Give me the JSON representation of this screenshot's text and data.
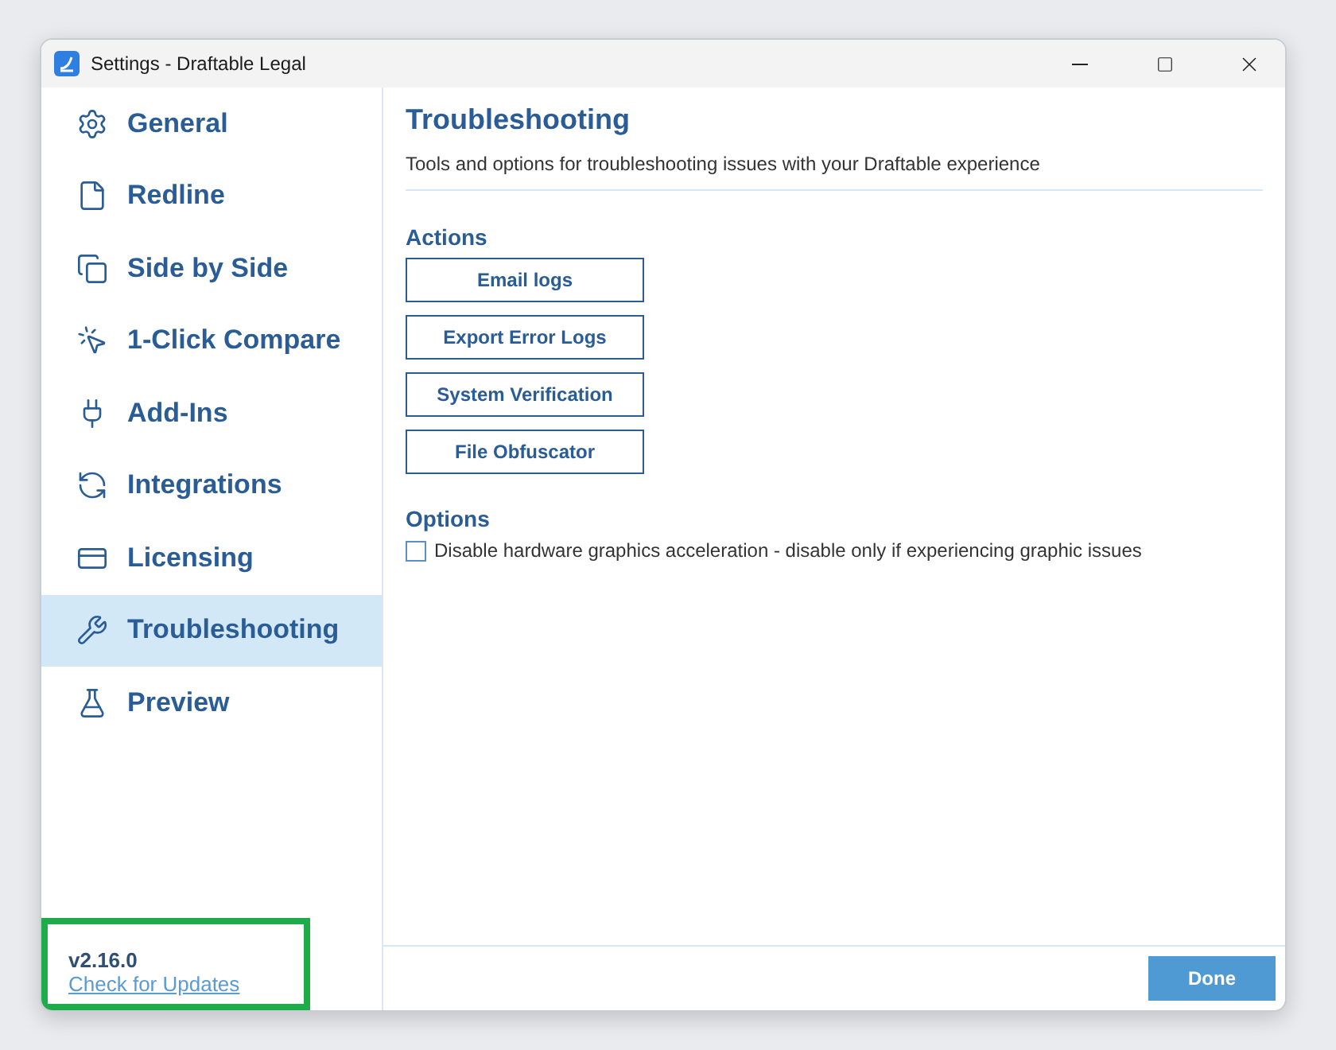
{
  "window": {
    "title": "Settings - Draftable Legal"
  },
  "sidebar": {
    "items": [
      {
        "label": "General",
        "selected": false
      },
      {
        "label": "Redline",
        "selected": false
      },
      {
        "label": "Side by Side",
        "selected": false
      },
      {
        "label": "1-Click Compare",
        "selected": false
      },
      {
        "label": "Add-Ins",
        "selected": false
      },
      {
        "label": "Integrations",
        "selected": false
      },
      {
        "label": "Licensing",
        "selected": false
      },
      {
        "label": "Troubleshooting",
        "selected": true
      },
      {
        "label": "Preview",
        "selected": false
      }
    ],
    "version": "v2.16.0",
    "update_link": "Check for Updates",
    "highlighted": true
  },
  "content": {
    "title": "Troubleshooting",
    "description": "Tools and options for troubleshooting issues with your Draftable experience",
    "actions_heading": "Actions",
    "actions": [
      "Email logs",
      "Export Error Logs",
      "System Verification",
      "File Obfuscator"
    ],
    "options_heading": "Options",
    "options": [
      {
        "label": "Disable hardware graphics acceleration - disable only if experiencing graphic issues",
        "checked": false
      }
    ]
  },
  "buttons": [
    "Done"
  ]
}
